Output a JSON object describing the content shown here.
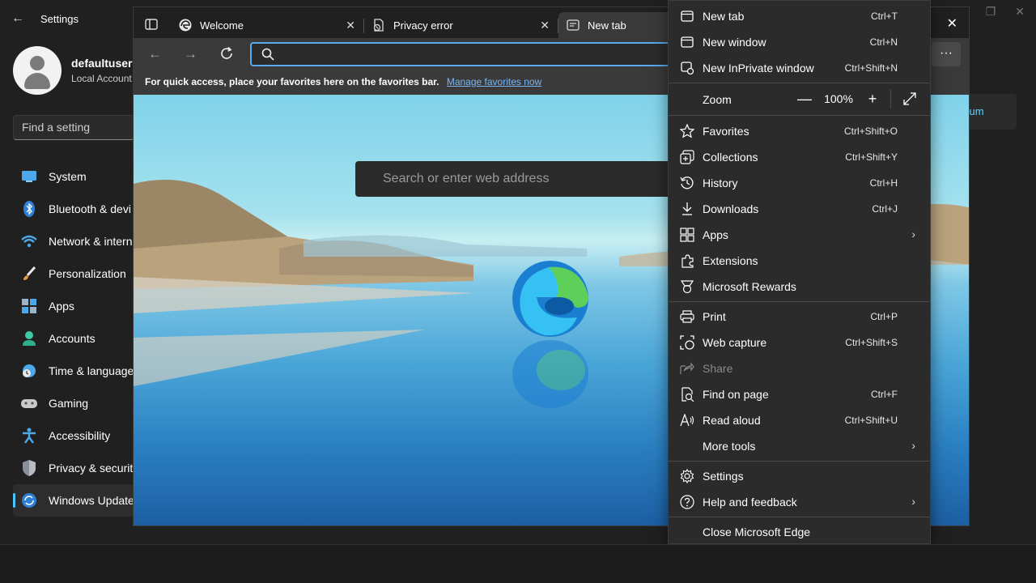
{
  "settings": {
    "title": "Settings",
    "user_name": "defaultuserO",
    "account_type": "Local Account",
    "search_placeholder": "Find a setting",
    "nav": [
      {
        "label": "System",
        "icon": "system-icon"
      },
      {
        "label": "Bluetooth & devi",
        "icon": "bluetooth-icon"
      },
      {
        "label": "Network & intern",
        "icon": "network-icon"
      },
      {
        "label": "Personalization",
        "icon": "brush-icon"
      },
      {
        "label": "Apps",
        "icon": "apps-icon"
      },
      {
        "label": "Accounts",
        "icon": "accounts-icon"
      },
      {
        "label": "Time & language",
        "icon": "clock-icon"
      },
      {
        "label": "Gaming",
        "icon": "gamepad-icon"
      },
      {
        "label": "Accessibility",
        "icon": "accessibility-icon"
      },
      {
        "label": "Privacy & security",
        "icon": "shield-icon"
      },
      {
        "label": "Windows Update",
        "icon": "update-icon"
      }
    ],
    "active_nav": "Windows Update",
    "right_card_text": "orum"
  },
  "edge": {
    "tabs": [
      {
        "title": "Welcome",
        "icon": "edge-logo-icon"
      },
      {
        "title": "Privacy error",
        "icon": "privacy-error-icon"
      },
      {
        "title": "New tab",
        "icon": "new-tab-icon",
        "active": true
      }
    ],
    "address_value": "",
    "favorites_hint": "For quick access, place your favorites here on the favorites bar.",
    "favorites_link": "Manage favorites now",
    "ntp_search_placeholder": "Search or enter web address",
    "more_label": "···"
  },
  "menu": {
    "items": [
      {
        "label": "New tab",
        "shortcut": "Ctrl+T",
        "icon": "new-tab-icon"
      },
      {
        "label": "New window",
        "shortcut": "Ctrl+N",
        "icon": "window-icon"
      },
      {
        "label": "New InPrivate window",
        "shortcut": "Ctrl+Shift+N",
        "icon": "inprivate-icon"
      },
      {
        "label": "Zoom",
        "icon": "none"
      },
      {
        "label": "Favorites",
        "shortcut": "Ctrl+Shift+O",
        "icon": "star-icon"
      },
      {
        "label": "Collections",
        "shortcut": "Ctrl+Shift+Y",
        "icon": "collections-icon"
      },
      {
        "label": "History",
        "shortcut": "Ctrl+H",
        "icon": "history-icon"
      },
      {
        "label": "Downloads",
        "shortcut": "Ctrl+J",
        "icon": "download-icon"
      },
      {
        "label": "Apps",
        "submenu": true,
        "icon": "apps-icon"
      },
      {
        "label": "Extensions",
        "icon": "extensions-icon"
      },
      {
        "label": "Microsoft Rewards",
        "icon": "rewards-icon"
      },
      {
        "label": "Print",
        "shortcut": "Ctrl+P",
        "icon": "print-icon"
      },
      {
        "label": "Web capture",
        "shortcut": "Ctrl+Shift+S",
        "icon": "web-capture-icon"
      },
      {
        "label": "Share",
        "disabled": true,
        "icon": "share-icon"
      },
      {
        "label": "Find on page",
        "shortcut": "Ctrl+F",
        "icon": "find-icon"
      },
      {
        "label": "Read aloud",
        "shortcut": "Ctrl+Shift+U",
        "icon": "read-aloud-icon"
      },
      {
        "label": "More tools",
        "submenu": true,
        "icon": "none"
      },
      {
        "label": "Settings",
        "icon": "gear-icon"
      },
      {
        "label": "Help and feedback",
        "submenu": true,
        "icon": "help-icon"
      },
      {
        "label": "Close Microsoft Edge",
        "icon": "none"
      }
    ],
    "zoom_value": "100%",
    "zoom_out": "—",
    "zoom_in": "+"
  },
  "colors": {
    "accent": "#4cc2ff",
    "link": "#7ab8f5",
    "menu_bg": "#2b2b2b"
  }
}
